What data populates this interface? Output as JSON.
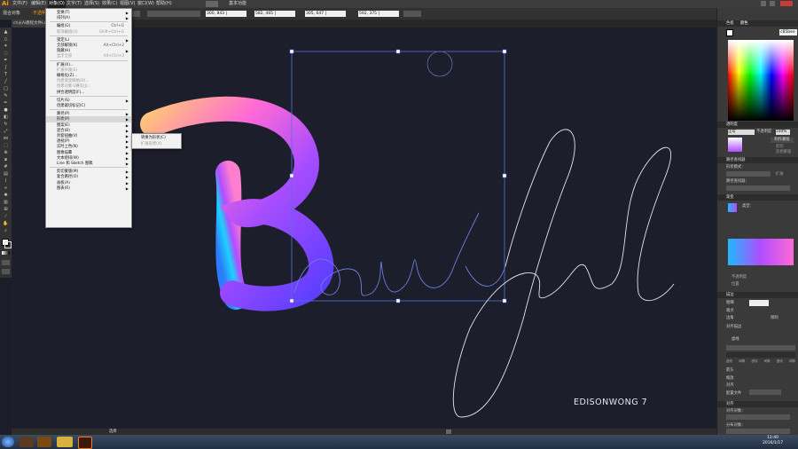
{
  "app": {
    "logo": "Ai",
    "menus": [
      "文件(F)",
      "编辑(E)",
      "对象(O)",
      "文字(T)",
      "选择(S)",
      "效果(C)",
      "视图(V)",
      "窗口(W)",
      "帮助(H)"
    ],
    "active_menu_index": 2,
    "workspace": "基本功能"
  },
  "control_bar": {
    "selection_label": "混合对象",
    "style_label": "不透明度",
    "fields": [
      "300, 843 |",
      "582, 465 |",
      "305, 647 |",
      "592, 375 |"
    ]
  },
  "document_tab": {
    "title": "ch从Ai教程文件Lo..."
  },
  "object_menu": {
    "items": [
      {
        "label": "变换(T)",
        "shortcut": "",
        "sub": true,
        "disabled": false
      },
      {
        "label": "排列(A)",
        "shortcut": "",
        "sub": true,
        "disabled": false
      },
      {
        "sep": true
      },
      {
        "label": "编组(G)",
        "shortcut": "Ctrl+G",
        "sub": false,
        "disabled": false
      },
      {
        "label": "取消编组(U)",
        "shortcut": "Shift+Ctrl+G",
        "sub": false,
        "disabled": true
      },
      {
        "sep": true
      },
      {
        "label": "锁定(L)",
        "shortcut": "",
        "sub": true,
        "disabled": false
      },
      {
        "label": "全部解锁(K)",
        "shortcut": "Alt+Ctrl+2",
        "sub": false,
        "disabled": false
      },
      {
        "label": "隐藏(H)",
        "shortcut": "",
        "sub": true,
        "disabled": false
      },
      {
        "label": "显示全部",
        "shortcut": "Alt+Ctrl+3",
        "sub": false,
        "disabled": true
      },
      {
        "sep": true
      },
      {
        "label": "扩展(X)...",
        "shortcut": "",
        "sub": false,
        "disabled": false
      },
      {
        "label": "扩展外观(E)",
        "shortcut": "",
        "sub": false,
        "disabled": true
      },
      {
        "label": "栅格化(Z)...",
        "shortcut": "",
        "sub": false,
        "disabled": false
      },
      {
        "label": "创建渐变网格(D)...",
        "shortcut": "",
        "sub": false,
        "disabled": true
      },
      {
        "label": "创建对象马赛克(J)...",
        "shortcut": "",
        "sub": false,
        "disabled": true
      },
      {
        "label": "拼合透明度(F)...",
        "shortcut": "",
        "sub": false,
        "disabled": false
      },
      {
        "sep": true
      },
      {
        "label": "切片(S)",
        "shortcut": "",
        "sub": true,
        "disabled": false
      },
      {
        "label": "创建裁切标记(C)",
        "shortcut": "",
        "sub": false,
        "disabled": false
      },
      {
        "sep": true
      },
      {
        "label": "路径(P)",
        "shortcut": "",
        "sub": true,
        "disabled": false
      },
      {
        "label": "形状(P)",
        "shortcut": "",
        "sub": true,
        "disabled": false,
        "highlight": true
      },
      {
        "label": "图案(E)",
        "shortcut": "",
        "sub": true,
        "disabled": false
      },
      {
        "label": "混合(B)",
        "shortcut": "",
        "sub": true,
        "disabled": false
      },
      {
        "label": "封套扭曲(V)",
        "shortcut": "",
        "sub": true,
        "disabled": false
      },
      {
        "label": "透视(P)",
        "shortcut": "",
        "sub": true,
        "disabled": false
      },
      {
        "label": "实时上色(N)",
        "shortcut": "",
        "sub": true,
        "disabled": false
      },
      {
        "label": "图像描摹",
        "shortcut": "",
        "sub": true,
        "disabled": false
      },
      {
        "label": "文本绕排(W)",
        "shortcut": "",
        "sub": true,
        "disabled": false
      },
      {
        "label": "Line 和 Sketch 图稿",
        "shortcut": "",
        "sub": true,
        "disabled": false
      },
      {
        "sep": true
      },
      {
        "label": "剪切蒙版(M)",
        "shortcut": "",
        "sub": true,
        "disabled": false
      },
      {
        "label": "复合路径(O)",
        "shortcut": "",
        "sub": true,
        "disabled": false
      },
      {
        "label": "画板(A)",
        "shortcut": "",
        "sub": true,
        "disabled": false
      },
      {
        "label": "图表(R)",
        "shortcut": "",
        "sub": true,
        "disabled": false
      }
    ]
  },
  "shape_submenu": {
    "items": [
      "转换为形状(C)",
      "扩展形状(X)"
    ]
  },
  "artwork": {
    "signature": "EDISONWONG 7",
    "script_text": "Beautifeel"
  },
  "panels": {
    "color_tabs": [
      "色板",
      "颜色"
    ],
    "color_hex": "c85bee",
    "transparency_title": "透明度",
    "blend_mode": "正常",
    "opacity_label": "不透明度",
    "opacity": "100%",
    "mask_button": "制作蒙版",
    "clip_label": "剪切",
    "invert_label": "反相蒙版",
    "pathfinder_title": "路径查找器",
    "shape_modes": "形状模式：",
    "pathfinders": "路径查找器：",
    "expand_button": "扩展",
    "gradient_title": "渐变",
    "gradient_type_label": "类型：",
    "gradient_opacity": "不透明度",
    "gradient_location": "位置",
    "stroke_title": "描边",
    "weight_label": "粗细",
    "cap_label": "端点",
    "corner_label": "边角",
    "limit_label": "限制",
    "align_label": "对齐描边",
    "dashed_label": "虚线",
    "dash_labels": [
      "虚线",
      "间隙",
      "虚线",
      "间隙",
      "虚线",
      "间隙"
    ],
    "arrow_label": "箭头",
    "scale_label": "缩放",
    "align_arrow_label": "对齐",
    "profile_label": "配置文件",
    "appearance_title": "对齐",
    "align_objects_label": "对齐对象：",
    "distribute_label": "分布对象："
  },
  "status_bar": {
    "zoom": "选择"
  },
  "taskbar": {
    "time": "12:40",
    "date": "2016/1/17"
  },
  "colors": {
    "menubar": "#3c3c3c",
    "canvas": "#1d1e2c",
    "gradient_start": "#1fb8ff",
    "gradient_mid": "#b14dff",
    "gradient_end": "#ff6ad5"
  }
}
